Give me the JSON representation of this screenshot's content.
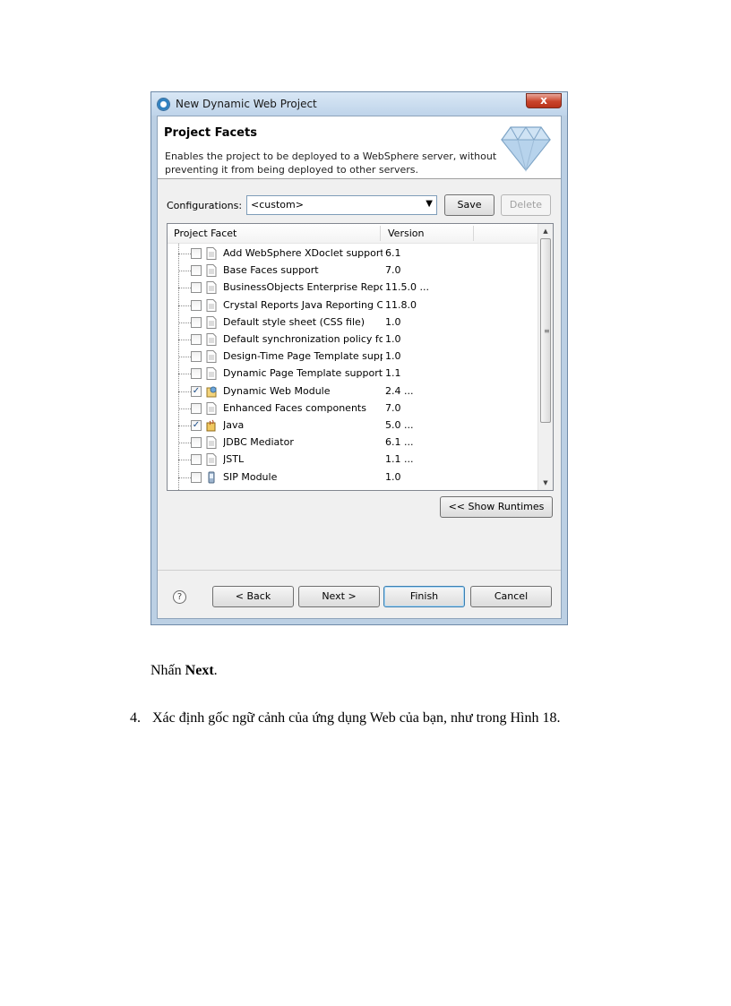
{
  "dialog": {
    "title": "New Dynamic Web Project",
    "close_label": "x",
    "banner": {
      "title": "Project Facets",
      "description": "Enables the project to be deployed to a WebSphere server, without preventing it from being deployed to other servers."
    },
    "configurations": {
      "label": "Configurations:",
      "selected": "<custom>",
      "save_label": "Save",
      "delete_label": "Delete"
    },
    "table": {
      "columns": [
        "Project Facet",
        "Version"
      ],
      "rows": [
        {
          "name": "Add WebSphere XDoclet support",
          "version": "6.1",
          "checked": false,
          "icon": "document-icon"
        },
        {
          "name": "Base Faces support",
          "version": "7.0",
          "checked": false,
          "icon": "document-icon"
        },
        {
          "name": "BusinessObjects Enterprise Report",
          "version": "11.5.0 ...",
          "checked": false,
          "icon": "document-icon"
        },
        {
          "name": "Crystal Reports Java Reporting Co",
          "version": "11.8.0",
          "checked": false,
          "icon": "document-icon"
        },
        {
          "name": "Default style sheet (CSS file)",
          "version": "1.0",
          "checked": false,
          "icon": "document-icon"
        },
        {
          "name": "Default synchronization policy for",
          "version": "1.0",
          "checked": false,
          "icon": "document-icon"
        },
        {
          "name": "Design-Time Page Template supp",
          "version": "1.0",
          "checked": false,
          "icon": "document-icon"
        },
        {
          "name": "Dynamic Page Template support",
          "version": "1.1",
          "checked": false,
          "icon": "document-icon"
        },
        {
          "name": "Dynamic Web Module",
          "version": "2.4 ...",
          "checked": true,
          "icon": "web-module-icon"
        },
        {
          "name": "Enhanced Faces components",
          "version": "7.0",
          "checked": false,
          "icon": "document-icon"
        },
        {
          "name": "Java",
          "version": "5.0 ...",
          "checked": true,
          "icon": "java-icon"
        },
        {
          "name": "JDBC Mediator",
          "version": "6.1 ...",
          "checked": false,
          "icon": "document-icon"
        },
        {
          "name": "JSTL",
          "version": "1.1 ...",
          "checked": false,
          "icon": "document-icon"
        },
        {
          "name": "SIP Module",
          "version": "1.0",
          "checked": false,
          "icon": "sip-module-icon"
        }
      ]
    },
    "show_runtimes_label": "<< Show Runtimes",
    "buttons": {
      "back": "< Back",
      "next": "Next >",
      "finish": "Finish",
      "cancel": "Cancel"
    },
    "help_label": "?"
  },
  "document": {
    "caption_prefix": "Nhấn ",
    "caption_bold": "Next",
    "caption_suffix": ".",
    "step_number": "4.",
    "step_text": "Xác định gốc ngữ cảnh của ứng dụng Web của bạn, như trong Hình 18."
  }
}
